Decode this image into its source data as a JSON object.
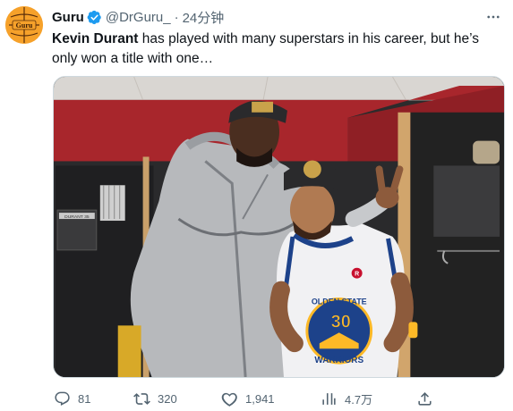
{
  "tweet": {
    "author": {
      "display_name": "Guru",
      "handle": "@DrGuru_",
      "verified": true,
      "avatar_text": "Guru"
    },
    "separator": "·",
    "time": "24分钟",
    "text_bold": "Kevin Durant",
    "text_rest": " has played with many superstars in his career, but he’s only won a title with one…",
    "media": {
      "jersey_text_top": "OLDEN STATE",
      "jersey_number": "30",
      "jersey_text_bottom": "WARRIORS",
      "locker_tag": "DURANT 35",
      "sponsor_patch": "R"
    },
    "actions": {
      "reply_count": "81",
      "retweet_count": "320",
      "like_count": "1,941",
      "views_count": "4.7万"
    }
  },
  "colors": {
    "accent": "#1d9bf0",
    "secondary_text": "#536471",
    "avatar_bg": "#f6a12a"
  }
}
